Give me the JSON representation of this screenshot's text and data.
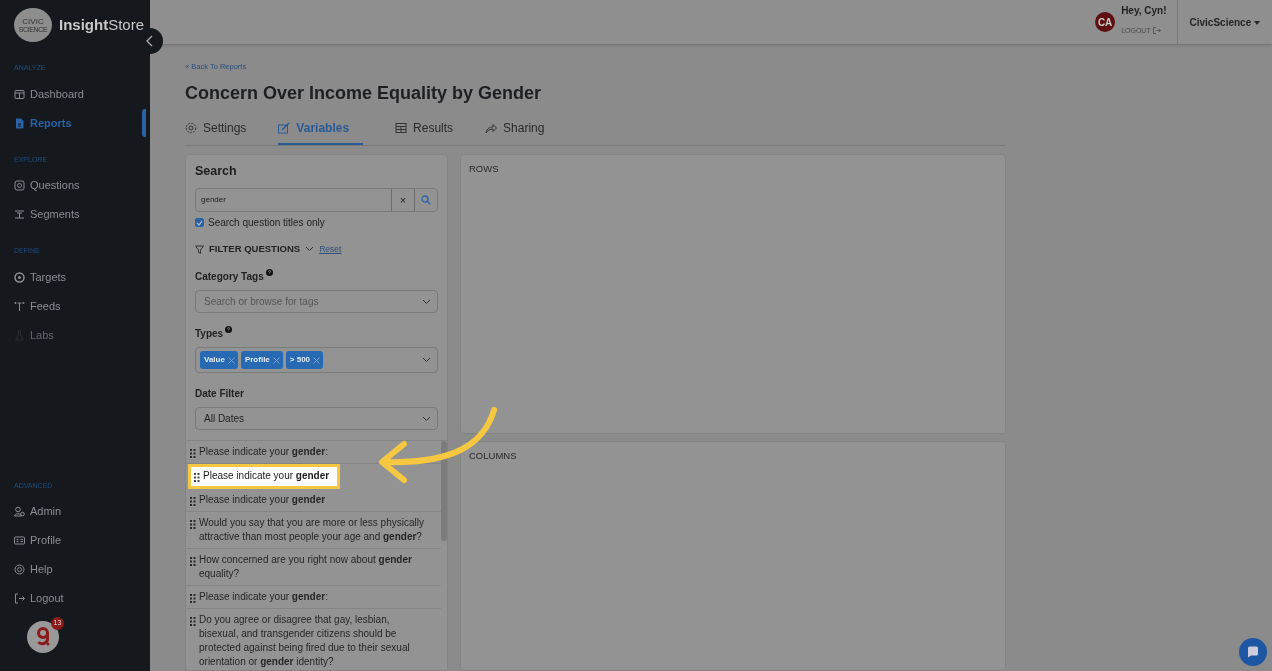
{
  "sidebar": {
    "logo_badge": [
      "CIVIC",
      "SCIENCE"
    ],
    "brand": "**Insight**Store",
    "sections": [
      {
        "title": "ANALYZE",
        "items": [
          {
            "label": "Dashboard",
            "selected": false,
            "disabled": false
          },
          {
            "label": "Reports",
            "selected": true,
            "disabled": false
          }
        ]
      },
      {
        "title": "EXPLORE",
        "items": [
          {
            "label": "Questions",
            "selected": false,
            "disabled": false
          },
          {
            "label": "Segments",
            "selected": false,
            "disabled": false
          }
        ]
      },
      {
        "title": "DEFINE",
        "items": [
          {
            "label": "Targets",
            "selected": false,
            "disabled": false
          },
          {
            "label": "Feeds",
            "selected": false,
            "disabled": false
          },
          {
            "label": "Labs",
            "selected": false,
            "disabled": true
          }
        ]
      },
      {
        "title": "ADVANCED",
        "items": [
          {
            "label": "Admin",
            "selected": false,
            "disabled": false
          },
          {
            "label": "Profile",
            "selected": false,
            "disabled": false
          },
          {
            "label": "Help",
            "selected": false,
            "disabled": false
          },
          {
            "label": "Logout",
            "selected": false,
            "disabled": false
          }
        ]
      }
    ],
    "badge_count": "13"
  },
  "header": {
    "initials": "CA",
    "greeting": "Hey, Cyn!",
    "logout": "LOGOUT",
    "org": "CivicScience"
  },
  "back_link": "« Back To Reports",
  "title": "Concern Over Income Equality by Gender",
  "tabs": [
    {
      "label": "Settings",
      "selected": false
    },
    {
      "label": "Variables",
      "selected": true
    },
    {
      "label": "Results",
      "selected": false
    },
    {
      "label": "Sharing",
      "selected": false
    }
  ],
  "search": {
    "title": "Search",
    "value": "gender",
    "clear": "×",
    "titles_only": {
      "label": "Search question titles only",
      "checked": true
    },
    "filter": "FILTER QUESTIONS",
    "reset": "Reset",
    "category_label": "Category Tags",
    "category_placeholder": "Search or browse for tags",
    "types_label": "Types",
    "types": [
      "Value",
      "Profile",
      "> 500"
    ],
    "date_label": "Date Filter",
    "date_value": "All Dates"
  },
  "questions": [
    {
      "text": "Please indicate your **gender**:",
      "highlighted": false
    },
    {
      "text": "Please indicate your **gender**",
      "highlighted": true
    },
    {
      "text": "Please indicate your **gender**",
      "highlighted": false
    },
    {
      "text": "Would you say that you are more or less physically attractive than most people your age and **gender**?",
      "highlighted": false
    },
    {
      "text": "How concerned are you right now about **gender** equality?",
      "highlighted": false
    },
    {
      "text": "Please indicate your **gender**:",
      "highlighted": false
    },
    {
      "text": "Do you agree or disagree that gay, lesbian, bisexual, and transgender citizens should be protected against being fired due to their sexual orientation or **gender** identity?",
      "highlighted": false
    }
  ],
  "panels": [
    "ROWS",
    "COLUMNS"
  ]
}
